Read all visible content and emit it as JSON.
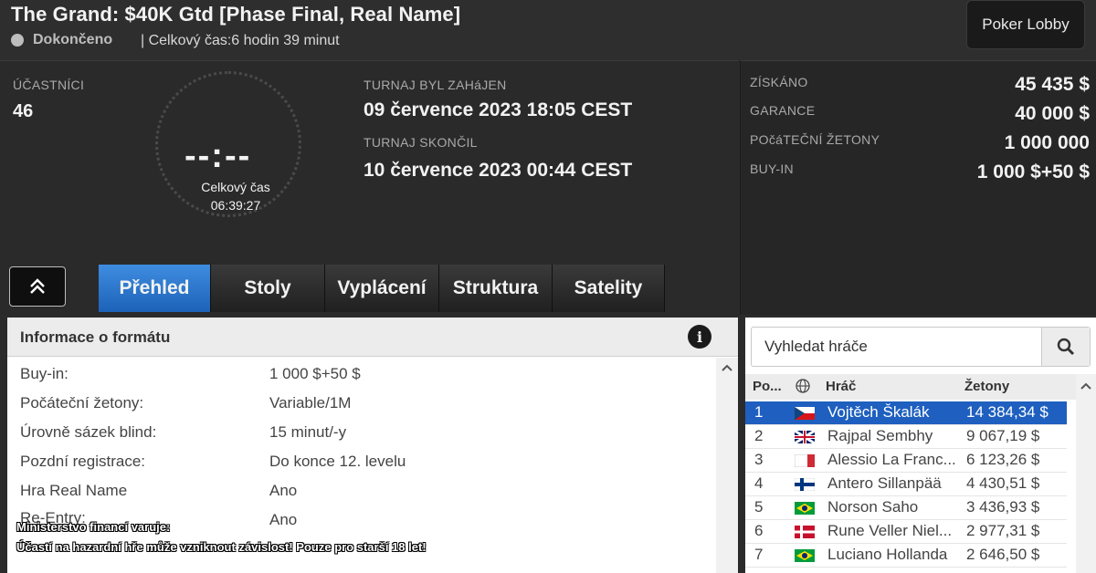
{
  "header": {
    "title": "The Grand: $40K Gtd [Phase Final, Real Name]",
    "status": "Dokončeno",
    "total_time": "| Celkový čas:6 hodin  39 minut",
    "lobby_button": "Poker Lobby"
  },
  "info": {
    "participants_label": "ÚČASTNÍCI",
    "participants_value": "46",
    "started_label": "TURNAJ BYL ZAHáJEN",
    "started_value": "09 července 2023  18:05 CEST",
    "ended_label": "TURNAJ SKONČIL",
    "ended_value": "10 července 2023  00:44 CEST",
    "clock_digits": "--:--",
    "clock_label": "Celkový čas",
    "clock_value": "06:39:27"
  },
  "stats": {
    "won_label": "ZÍSKÁNO",
    "won_value": "45 435 $",
    "guarantee_label": "GARANCE",
    "guarantee_value": "40 000 $",
    "chips_label": "POčáTEČNÍ ŽETONY",
    "chips_value": "1 000 000",
    "buyin_label": "BUY-IN",
    "buyin_value": "1 000 $+50 $"
  },
  "tabs": [
    "Přehled",
    "Stoly",
    "Vyplácení",
    "Struktura",
    "Satelity"
  ],
  "format": {
    "title": "Informace o formátu",
    "info_icon": "i",
    "rows": [
      {
        "label": "Buy-in:",
        "value": "1 000 $+50 $"
      },
      {
        "label": "Počáteční žetony:",
        "value": "Variable/1M"
      },
      {
        "label": "Úrovně sázek blind:",
        "value": "15 minut/-y"
      },
      {
        "label": "Pozdní registrace:",
        "value": "Do konce 12. levelu"
      },
      {
        "label": "Hra Real Name",
        "value": "Ano"
      },
      {
        "label": "Re-Entry:",
        "value": "Ano"
      }
    ]
  },
  "players": {
    "search_placeholder": "Vyhledat hráče",
    "col_pos": "Po...",
    "col_player": "Hráč",
    "col_chips": "Žetony",
    "rows": [
      {
        "pos": "1",
        "name": "Vojtěch Škalák",
        "chips": "14 384,34 $",
        "flag": "cz"
      },
      {
        "pos": "2",
        "name": "Rajpal Sembhy",
        "chips": "9 067,19 $",
        "flag": "gb"
      },
      {
        "pos": "3",
        "name": "Alessio La Franc...",
        "chips": "6 123,26 $",
        "flag": "it"
      },
      {
        "pos": "4",
        "name": "Antero Sillanpää",
        "chips": "4 430,51 $",
        "flag": "fi"
      },
      {
        "pos": "5",
        "name": "Norson Saho",
        "chips": "3 436,93 $",
        "flag": "br"
      },
      {
        "pos": "6",
        "name": "Rune Veller Niel...",
        "chips": "2 977,31 $",
        "flag": "dk"
      },
      {
        "pos": "7",
        "name": "Luciano Hollanda",
        "chips": "2 646,50 $",
        "flag": "br"
      }
    ]
  },
  "warning": {
    "line1": "Ministerstvo financí varuje:",
    "line2": "Účastí na hazardní hře může vzniknout závislost! Pouze pro starší 18 let!"
  }
}
